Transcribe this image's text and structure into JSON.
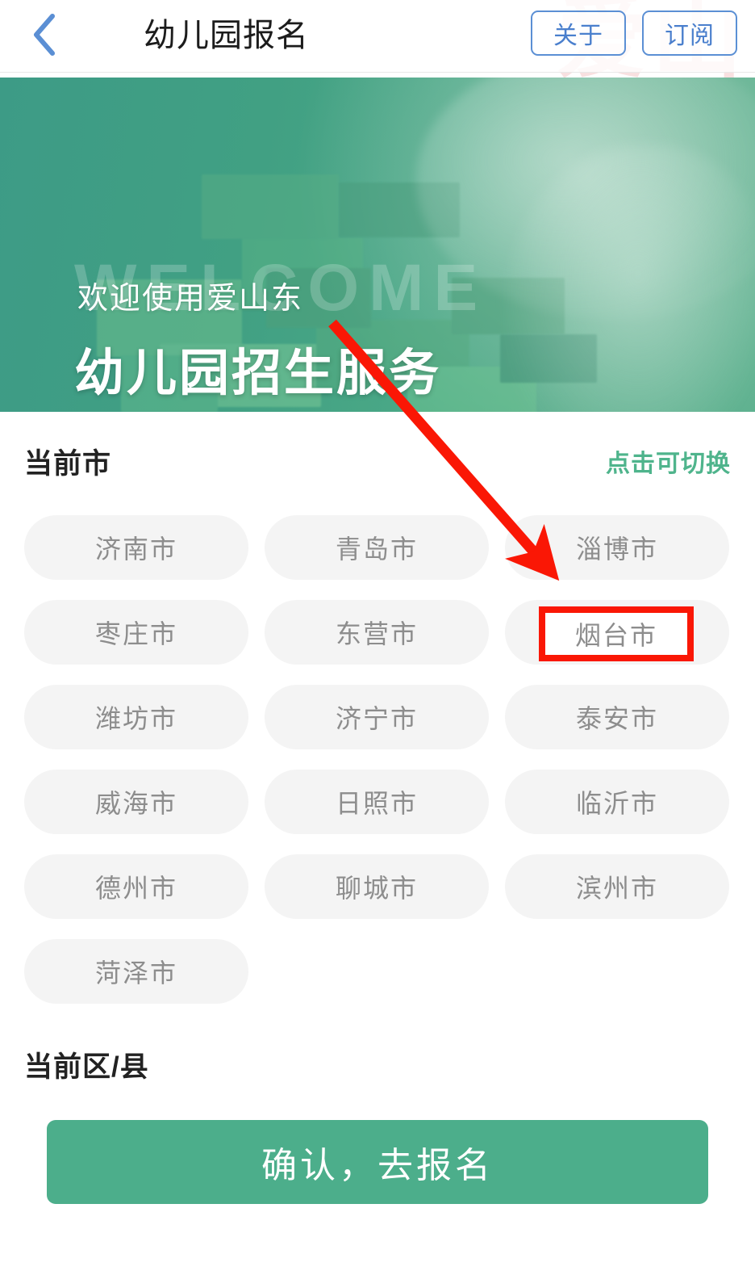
{
  "watermark": {
    "text": "爱山东\n幼儿园"
  },
  "header": {
    "back_icon": "chevron-left-icon",
    "title": "幼儿园报名",
    "about_label": "关于",
    "subscribe_label": "订阅"
  },
  "banner": {
    "ghost_text": "WELCOME",
    "subtitle": "欢迎使用爱山东",
    "title": "幼儿园招生服务"
  },
  "city_section": {
    "title": "当前市",
    "switch_hint": "点击可切换",
    "cities": [
      "济南市",
      "青岛市",
      "淄博市",
      "枣庄市",
      "东营市",
      "烟台市",
      "潍坊市",
      "济宁市",
      "泰安市",
      "威海市",
      "日照市",
      "临沂市",
      "德州市",
      "聊城市",
      "滨州市",
      "菏泽市"
    ],
    "highlighted_city": "烟台市"
  },
  "district_section": {
    "title": "当前区/县"
  },
  "confirm": {
    "label": "确认，去报名"
  },
  "colors": {
    "accent_green": "#4cae8b",
    "link_green": "#4fb48c",
    "header_blue": "#4a7fcd",
    "annotation_red": "#fa1705",
    "pill_bg": "#f4f4f4",
    "pill_text": "#8d8d8d"
  }
}
